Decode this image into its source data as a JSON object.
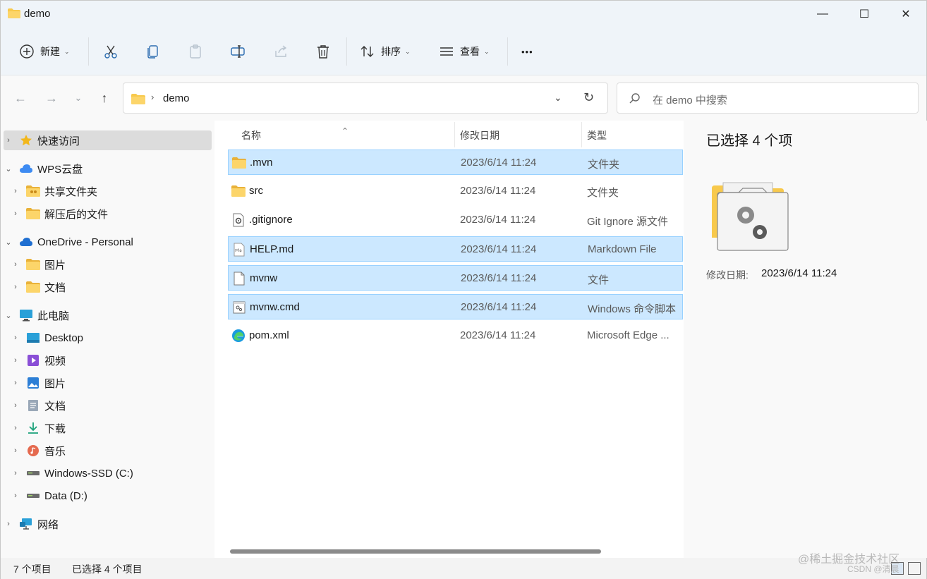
{
  "window": {
    "title": "demo",
    "min_glyph": "—",
    "max_glyph": "☐",
    "close_glyph": "✕"
  },
  "toolbar": {
    "new_label": "新建",
    "sort_label": "排序",
    "view_label": "查看",
    "more_label": "•••",
    "caret": "⌄"
  },
  "address": {
    "crumb": "demo",
    "chevron": "›",
    "dropdown": "⌄",
    "refresh": "↻"
  },
  "nav_buttons": {
    "back": "←",
    "forward": "→",
    "recent": "⌄",
    "up": "↑"
  },
  "search": {
    "placeholder": "在 demo 中搜索"
  },
  "sidebar": {
    "items": [
      {
        "label": "快速访问",
        "expander": "›",
        "icon": "star-icon"
      },
      {
        "label": "WPS云盘",
        "expander": "⌄",
        "icon": "cloud-icon"
      },
      {
        "label": "共享文件夹",
        "expander": "›",
        "icon": "shared-folder-icon"
      },
      {
        "label": "解压后的文件",
        "expander": "›",
        "icon": "folder-icon"
      },
      {
        "label": "OneDrive - Personal",
        "expander": "⌄",
        "icon": "onedrive-icon"
      },
      {
        "label": "图片",
        "expander": "›",
        "icon": "folder-icon"
      },
      {
        "label": "文档",
        "expander": "›",
        "icon": "folder-icon"
      },
      {
        "label": "此电脑",
        "expander": "⌄",
        "icon": "computer-icon"
      },
      {
        "label": "Desktop",
        "expander": "›",
        "icon": "desktop-icon"
      },
      {
        "label": "视频",
        "expander": "›",
        "icon": "video-icon"
      },
      {
        "label": "图片",
        "expander": "›",
        "icon": "pictures-icon"
      },
      {
        "label": "文档",
        "expander": "›",
        "icon": "documents-icon"
      },
      {
        "label": "下载",
        "expander": "›",
        "icon": "download-icon"
      },
      {
        "label": "音乐",
        "expander": "›",
        "icon": "music-icon"
      },
      {
        "label": "Windows-SSD (C:)",
        "expander": "›",
        "icon": "drive-icon"
      },
      {
        "label": "Data (D:)",
        "expander": "›",
        "icon": "drive-icon"
      },
      {
        "label": "网络",
        "expander": "›",
        "icon": "network-icon"
      }
    ]
  },
  "table": {
    "columns": {
      "name": "名称",
      "date": "修改日期",
      "type": "类型"
    },
    "sort_glyph": "⌃",
    "rows": [
      {
        "name": ".mvn",
        "date": "2023/6/14 11:24",
        "type": "文件夹",
        "icon": "folder-icon",
        "selected": true
      },
      {
        "name": "src",
        "date": "2023/6/14 11:24",
        "type": "文件夹",
        "icon": "folder-icon",
        "selected": false
      },
      {
        "name": ".gitignore",
        "date": "2023/6/14 11:24",
        "type": "Git Ignore 源文件",
        "icon": "gear-file-icon",
        "selected": false
      },
      {
        "name": "HELP.md",
        "date": "2023/6/14 11:24",
        "type": "Markdown File",
        "icon": "markdown-file-icon",
        "selected": true
      },
      {
        "name": "mvnw",
        "date": "2023/6/14 11:24",
        "type": "文件",
        "icon": "blank-file-icon",
        "selected": true
      },
      {
        "name": "mvnw.cmd",
        "date": "2023/6/14 11:24",
        "type": "Windows 命令脚本",
        "icon": "script-file-icon",
        "selected": true
      },
      {
        "name": "pom.xml",
        "date": "2023/6/14 11:24",
        "type": "Microsoft Edge ...",
        "icon": "edge-icon",
        "selected": false
      }
    ]
  },
  "details": {
    "title": "已选择 4 个项",
    "date_label": "修改日期:",
    "date_value": "2023/6/14 11:24"
  },
  "status": {
    "item_count": "7 个项目",
    "selected_count": "已选择 4 个项目"
  },
  "watermark": {
    "line1": "@稀土掘金技术社区",
    "line2": "CSDN @清晨"
  },
  "colors": {
    "selection_bg": "#cce8ff",
    "selection_border": "#99d1ff",
    "folder": "#f8c94c"
  }
}
